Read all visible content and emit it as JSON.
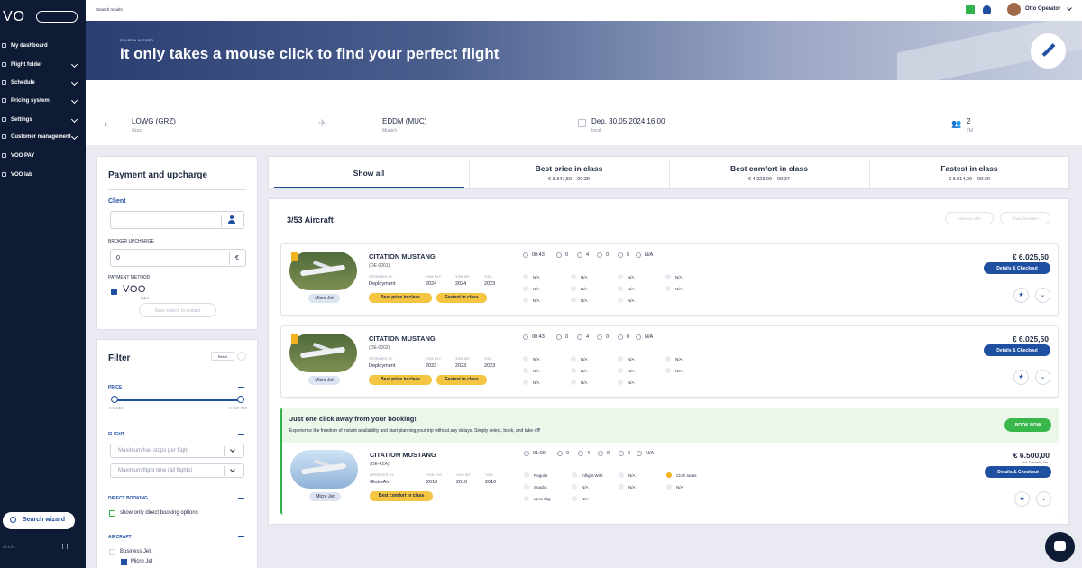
{
  "app": {
    "logo": "VO",
    "version": "v0.4.01"
  },
  "sidebar": {
    "items": [
      {
        "label": "My dashboard",
        "icon": "dashboard-icon",
        "chevron": false
      },
      {
        "label": "Flight folder",
        "icon": "folder-icon",
        "chevron": true
      },
      {
        "label": "Schedule",
        "icon": "calendar-icon",
        "chevron": true
      },
      {
        "label": "Pricing system",
        "icon": "dollar-icon",
        "chevron": true
      },
      {
        "label": "Settings",
        "icon": "gear-icon",
        "chevron": true
      },
      {
        "label": "Customer management",
        "icon": "users-icon",
        "chevron": true
      },
      {
        "label": "VOO PAY",
        "icon": "card-icon",
        "chevron": false
      },
      {
        "label": "VOO lab",
        "icon": "flask-icon",
        "chevron": false
      }
    ],
    "search_wizard": "Search wizard"
  },
  "topbar": {
    "breadcrumb": "Search results",
    "user_name": "Otto Operator"
  },
  "hero": {
    "kicker": "SEARCH WIZARD",
    "title": "It only takes a mouse click to find your perfect flight"
  },
  "route": {
    "leg_number": "1",
    "from_code": "LOWG (GRZ)",
    "from_city": "Graz",
    "to_code": "EDDM (MUC)",
    "to_city": "Munich",
    "departure": "Dep. 30.05.2024 16:00",
    "departure_tz": "local",
    "pax": "2",
    "pax_detail": "2M"
  },
  "payment": {
    "title": "Payment and upcharge",
    "client_label": "Client",
    "client_value": "",
    "upcharge_label": "BROKER UPCHARGE",
    "upcharge_value": "0",
    "currency": "€",
    "method_label": "PAYMENT METHOD",
    "voo_pay_logo": "VOO",
    "voo_pay_sub": "PAY",
    "save_button": "Save search to contact"
  },
  "filter": {
    "title": "Filter",
    "reset": "Reset",
    "price_label": "PRICE",
    "price_min": "€ 5.348",
    "price_max": "€ 127.720",
    "price_range_fraction": [
      0,
      1
    ],
    "flight_label": "FLIGHT",
    "fuel_stops_placeholder": "Maximum fuel stops per flight",
    "flight_time_placeholder": "Maximum flight time (all flights)",
    "direct_label": "DIRECT BOOKING",
    "direct_option": "show only direct booking options",
    "aircraft_label": "AIRCRAFT",
    "aircraft_options": [
      {
        "label": "Business Jet",
        "checked": false
      },
      {
        "label": "Micro Jet",
        "checked": true
      }
    ]
  },
  "tabs": [
    {
      "title": "Show all",
      "price": "",
      "time": ""
    },
    {
      "title": "Best price in class",
      "price": "€    3.347,50",
      "time": "00:39"
    },
    {
      "title": "Best comfort in class",
      "price": "€    4.223,00",
      "time": "00:37"
    },
    {
      "title": "Fastest in class",
      "price": "€    3.914,00",
      "time": "00:30"
    }
  ],
  "results": {
    "count": "3/53 Aircraft",
    "save_offer": "Save as offer",
    "show_favorites": "Show favorites",
    "details_label": "Details & Checkout",
    "operated_by_label": "OPERATED BY",
    "yom_ext_label": "YOM EXT.",
    "yom_int_label": "YOM INT.",
    "yom_label": "YOM",
    "cards": [
      {
        "name": "CITATION MUSTANG",
        "reg": "(OE-0001)",
        "class": "Micro Jet",
        "operator": "Deployment",
        "yom_ext": "2024",
        "yom_int": "2024",
        "yom": "2023",
        "tags": [
          "Best price in class",
          "Fastest in class"
        ],
        "duration": "00:43",
        "stops": "0",
        "seats": "4",
        "pets": "0",
        "bags": "5",
        "wifi": "N/A",
        "amenities": [
          "N/A",
          "N/A",
          "N/A",
          "N/A",
          "N/A",
          "N/A",
          "N/A",
          "N/A",
          "N/A",
          "N/A",
          "N/A"
        ],
        "price": "€ 6.025,50",
        "price_note": ""
      },
      {
        "name": "CITATION MUSTANG",
        "reg": "(OE-0002)",
        "class": "Micro Jet",
        "operator": "Deployment",
        "yom_ext": "2023",
        "yom_int": "2023",
        "yom": "2023",
        "tags": [
          "Best price in class",
          "Fastest in class"
        ],
        "duration": "00:43",
        "stops": "0",
        "seats": "4",
        "pets": "0",
        "bags": "0",
        "wifi": "N/A",
        "amenities": [
          "N/A",
          "N/A",
          "N/A",
          "N/A",
          "N/A",
          "N/A",
          "N/A",
          "N/A",
          "N/A",
          "N/A",
          "N/A"
        ],
        "price": "€ 6.025,50",
        "price_note": ""
      },
      {
        "name": "CITATION MUSTANG",
        "reg": "(OE-FZA)",
        "class": "Micro Jet",
        "operator": "GlobeAir",
        "yom_ext": "2010",
        "yom_int": "2010",
        "yom": "2010",
        "tags": [
          "Best comfort in class"
        ],
        "duration": "01:00",
        "stops": "0",
        "seats": "4",
        "pets": "0",
        "bags": "0",
        "wifi": "N/A",
        "amenities": [
          "Regular",
          "Inflight WiFi",
          "N/A",
          "Cloth seats",
          "Snacks",
          "N/A",
          "N/A",
          "N/A",
          "up to 5kg",
          "N/A"
        ],
        "price": "€ 6.500,00",
        "price_note": "incl. Domestic Tax"
      }
    ]
  },
  "promo": {
    "title": "Just one click away from your booking!",
    "text": "Experience the freedom of instant availability and start planning your trip without any delays. Simply select, book, and take off!",
    "button": "BOOK NOW"
  },
  "colors": {
    "navy": "#0d1b34",
    "accent": "#1f4fa0",
    "tag": "#f4c542",
    "green": "#38b84a"
  }
}
